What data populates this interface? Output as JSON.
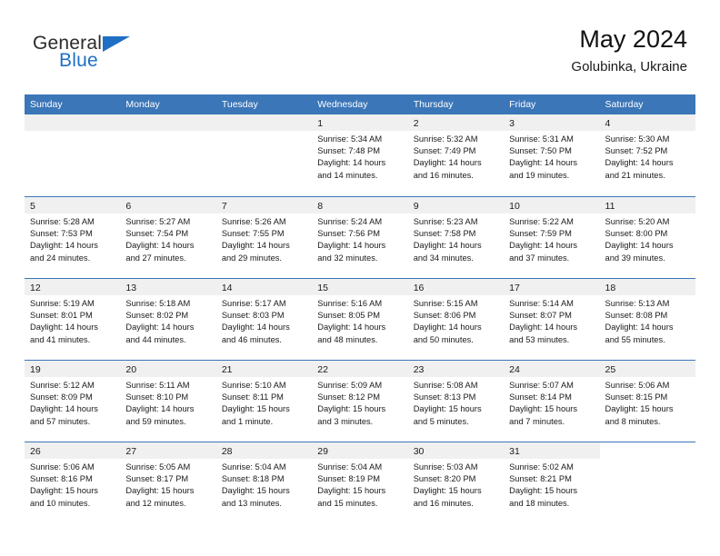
{
  "brand": {
    "word_one": "General",
    "word_two": "Blue",
    "flag_icon": "triangle-flag-icon",
    "accent_color": "#1f6fc4"
  },
  "header": {
    "title": "May 2024",
    "location": "Golubinka, Ukraine"
  },
  "theme": {
    "header_blue": "#3b76b8",
    "daynum_band": "#f0f0f0",
    "text": "#1a1a1a"
  },
  "calendar": {
    "weekday_headers": [
      "Sunday",
      "Monday",
      "Tuesday",
      "Wednesday",
      "Thursday",
      "Friday",
      "Saturday"
    ],
    "weeks": [
      [
        {
          "blank": true
        },
        {
          "blank": true
        },
        {
          "blank": true
        },
        {
          "day": "1",
          "sunrise": "Sunrise: 5:34 AM",
          "sunset": "Sunset: 7:48 PM",
          "daylight_1": "Daylight: 14 hours",
          "daylight_2": "and 14 minutes."
        },
        {
          "day": "2",
          "sunrise": "Sunrise: 5:32 AM",
          "sunset": "Sunset: 7:49 PM",
          "daylight_1": "Daylight: 14 hours",
          "daylight_2": "and 16 minutes."
        },
        {
          "day": "3",
          "sunrise": "Sunrise: 5:31 AM",
          "sunset": "Sunset: 7:50 PM",
          "daylight_1": "Daylight: 14 hours",
          "daylight_2": "and 19 minutes."
        },
        {
          "day": "4",
          "sunrise": "Sunrise: 5:30 AM",
          "sunset": "Sunset: 7:52 PM",
          "daylight_1": "Daylight: 14 hours",
          "daylight_2": "and 21 minutes."
        }
      ],
      [
        {
          "day": "5",
          "sunrise": "Sunrise: 5:28 AM",
          "sunset": "Sunset: 7:53 PM",
          "daylight_1": "Daylight: 14 hours",
          "daylight_2": "and 24 minutes."
        },
        {
          "day": "6",
          "sunrise": "Sunrise: 5:27 AM",
          "sunset": "Sunset: 7:54 PM",
          "daylight_1": "Daylight: 14 hours",
          "daylight_2": "and 27 minutes."
        },
        {
          "day": "7",
          "sunrise": "Sunrise: 5:26 AM",
          "sunset": "Sunset: 7:55 PM",
          "daylight_1": "Daylight: 14 hours",
          "daylight_2": "and 29 minutes."
        },
        {
          "day": "8",
          "sunrise": "Sunrise: 5:24 AM",
          "sunset": "Sunset: 7:56 PM",
          "daylight_1": "Daylight: 14 hours",
          "daylight_2": "and 32 minutes."
        },
        {
          "day": "9",
          "sunrise": "Sunrise: 5:23 AM",
          "sunset": "Sunset: 7:58 PM",
          "daylight_1": "Daylight: 14 hours",
          "daylight_2": "and 34 minutes."
        },
        {
          "day": "10",
          "sunrise": "Sunrise: 5:22 AM",
          "sunset": "Sunset: 7:59 PM",
          "daylight_1": "Daylight: 14 hours",
          "daylight_2": "and 37 minutes."
        },
        {
          "day": "11",
          "sunrise": "Sunrise: 5:20 AM",
          "sunset": "Sunset: 8:00 PM",
          "daylight_1": "Daylight: 14 hours",
          "daylight_2": "and 39 minutes."
        }
      ],
      [
        {
          "day": "12",
          "sunrise": "Sunrise: 5:19 AM",
          "sunset": "Sunset: 8:01 PM",
          "daylight_1": "Daylight: 14 hours",
          "daylight_2": "and 41 minutes."
        },
        {
          "day": "13",
          "sunrise": "Sunrise: 5:18 AM",
          "sunset": "Sunset: 8:02 PM",
          "daylight_1": "Daylight: 14 hours",
          "daylight_2": "and 44 minutes."
        },
        {
          "day": "14",
          "sunrise": "Sunrise: 5:17 AM",
          "sunset": "Sunset: 8:03 PM",
          "daylight_1": "Daylight: 14 hours",
          "daylight_2": "and 46 minutes."
        },
        {
          "day": "15",
          "sunrise": "Sunrise: 5:16 AM",
          "sunset": "Sunset: 8:05 PM",
          "daylight_1": "Daylight: 14 hours",
          "daylight_2": "and 48 minutes."
        },
        {
          "day": "16",
          "sunrise": "Sunrise: 5:15 AM",
          "sunset": "Sunset: 8:06 PM",
          "daylight_1": "Daylight: 14 hours",
          "daylight_2": "and 50 minutes."
        },
        {
          "day": "17",
          "sunrise": "Sunrise: 5:14 AM",
          "sunset": "Sunset: 8:07 PM",
          "daylight_1": "Daylight: 14 hours",
          "daylight_2": "and 53 minutes."
        },
        {
          "day": "18",
          "sunrise": "Sunrise: 5:13 AM",
          "sunset": "Sunset: 8:08 PM",
          "daylight_1": "Daylight: 14 hours",
          "daylight_2": "and 55 minutes."
        }
      ],
      [
        {
          "day": "19",
          "sunrise": "Sunrise: 5:12 AM",
          "sunset": "Sunset: 8:09 PM",
          "daylight_1": "Daylight: 14 hours",
          "daylight_2": "and 57 minutes."
        },
        {
          "day": "20",
          "sunrise": "Sunrise: 5:11 AM",
          "sunset": "Sunset: 8:10 PM",
          "daylight_1": "Daylight: 14 hours",
          "daylight_2": "and 59 minutes."
        },
        {
          "day": "21",
          "sunrise": "Sunrise: 5:10 AM",
          "sunset": "Sunset: 8:11 PM",
          "daylight_1": "Daylight: 15 hours",
          "daylight_2": "and 1 minute."
        },
        {
          "day": "22",
          "sunrise": "Sunrise: 5:09 AM",
          "sunset": "Sunset: 8:12 PM",
          "daylight_1": "Daylight: 15 hours",
          "daylight_2": "and 3 minutes."
        },
        {
          "day": "23",
          "sunrise": "Sunrise: 5:08 AM",
          "sunset": "Sunset: 8:13 PM",
          "daylight_1": "Daylight: 15 hours",
          "daylight_2": "and 5 minutes."
        },
        {
          "day": "24",
          "sunrise": "Sunrise: 5:07 AM",
          "sunset": "Sunset: 8:14 PM",
          "daylight_1": "Daylight: 15 hours",
          "daylight_2": "and 7 minutes."
        },
        {
          "day": "25",
          "sunrise": "Sunrise: 5:06 AM",
          "sunset": "Sunset: 8:15 PM",
          "daylight_1": "Daylight: 15 hours",
          "daylight_2": "and 8 minutes."
        }
      ],
      [
        {
          "day": "26",
          "sunrise": "Sunrise: 5:06 AM",
          "sunset": "Sunset: 8:16 PM",
          "daylight_1": "Daylight: 15 hours",
          "daylight_2": "and 10 minutes."
        },
        {
          "day": "27",
          "sunrise": "Sunrise: 5:05 AM",
          "sunset": "Sunset: 8:17 PM",
          "daylight_1": "Daylight: 15 hours",
          "daylight_2": "and 12 minutes."
        },
        {
          "day": "28",
          "sunrise": "Sunrise: 5:04 AM",
          "sunset": "Sunset: 8:18 PM",
          "daylight_1": "Daylight: 15 hours",
          "daylight_2": "and 13 minutes."
        },
        {
          "day": "29",
          "sunrise": "Sunrise: 5:04 AM",
          "sunset": "Sunset: 8:19 PM",
          "daylight_1": "Daylight: 15 hours",
          "daylight_2": "and 15 minutes."
        },
        {
          "day": "30",
          "sunrise": "Sunrise: 5:03 AM",
          "sunset": "Sunset: 8:20 PM",
          "daylight_1": "Daylight: 15 hours",
          "daylight_2": "and 16 minutes."
        },
        {
          "day": "31",
          "sunrise": "Sunrise: 5:02 AM",
          "sunset": "Sunset: 8:21 PM",
          "daylight_1": "Daylight: 15 hours",
          "daylight_2": "and 18 minutes."
        },
        {
          "blank": true,
          "no_band": true
        }
      ]
    ]
  }
}
